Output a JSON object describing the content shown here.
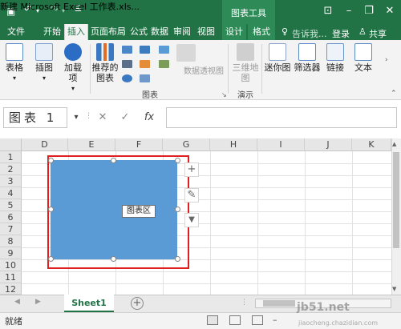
{
  "window": {
    "title": "新建 Microsoft Excel 工作表.xls...",
    "context_tab_title": "图表工具",
    "minimize": "–",
    "restore": "❐",
    "close": "✕",
    "ribbon_options": "⊡"
  },
  "tabs": [
    "文件",
    "开始",
    "插入",
    "页面布局",
    "公式",
    "数据",
    "审阅",
    "视图",
    "设计",
    "格式"
  ],
  "tell_me": "告诉我...",
  "signin": "登录",
  "share": "共享",
  "ribbon": {
    "table": "表格",
    "illustrations": "插图",
    "addins_1": "加载",
    "addins_2": "项",
    "recommended_1": "推荐的",
    "recommended_2": "图表",
    "pivotchart": "数据透视图",
    "map_1": "三维地",
    "map_2": "图",
    "sparklines": "迷你图",
    "filters": "筛选器",
    "links": "链接",
    "text": "文本",
    "group_charts": "图表",
    "group_tours": "演示"
  },
  "formula": {
    "name_box": "图表 1",
    "cancel": "✕",
    "enter": "✓",
    "fx": "fx",
    "value": ""
  },
  "columns": [
    "D",
    "E",
    "F",
    "G",
    "H",
    "I",
    "J",
    "K"
  ],
  "rows": [
    "1",
    "2",
    "3",
    "4",
    "5",
    "6",
    "7",
    "8",
    "9",
    "10",
    "11",
    "12"
  ],
  "chart": {
    "tooltip": "图表区",
    "fill_color": "#5b9bd5",
    "highlight_color": "#e02020",
    "side_buttons": [
      "+",
      "✎",
      "▼"
    ]
  },
  "sheets": [
    "Sheet1"
  ],
  "add_sheet": "+",
  "status": "就绪",
  "watermark": "jb51.net",
  "watermark_sub": "jiaocheng.chazidian.com",
  "colors": {
    "excel_green": "#217346"
  }
}
